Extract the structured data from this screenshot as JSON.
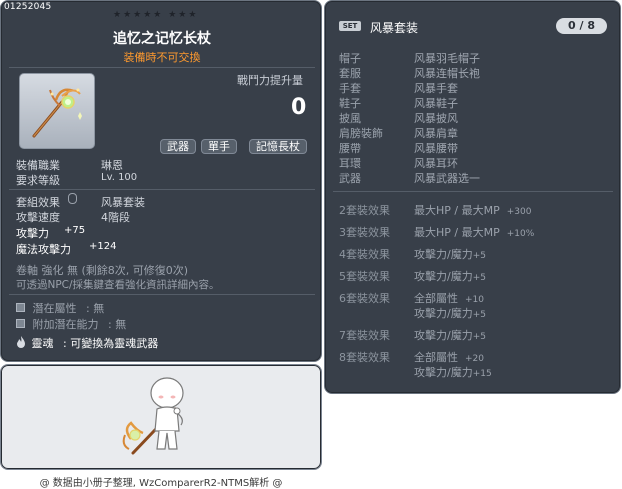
{
  "item": {
    "id": "01252045",
    "stars": "★★★★★  ★★★",
    "title": "追忆之记忆长杖",
    "untradable": "装備時不可交換",
    "combat_power_label": "戰鬥力提升量",
    "combat_power_value": "0",
    "tags": [
      "武器",
      "單手",
      "記憶長杖"
    ],
    "job_label": "裝備職業",
    "job_value": "琳恩",
    "level_label": "要求等級",
    "level_value": "Lv. 100",
    "set_label": "套組效果",
    "set_value": "风暴套装",
    "speed_label": "攻擊速度",
    "speed_value": "4階段",
    "atk_label": "攻擊力",
    "atk_value": "+75",
    "matk_label": "魔法攻擊力",
    "matk_value": "+124",
    "scroll_line": "卷軸 強化 無 (剩餘8次, 可修復0次)",
    "npc_note": "可透過NPC/採集鍵查看強化資訊詳細內容。",
    "potential_label": "潛在屬性",
    "potential_value": ": 無",
    "bonus_potential_label": "附加潛在能力",
    "bonus_potential_value": ": 無",
    "soul_label": "靈魂",
    "soul_value": ": 可變換為靈魂武器"
  },
  "set": {
    "badge": "SET",
    "name": "风暴套装",
    "count": "0 / 8",
    "parts": [
      {
        "slot": "帽子",
        "name": "风暴羽毛帽子"
      },
      {
        "slot": "套服",
        "name": "风暴连帽长袍"
      },
      {
        "slot": "手套",
        "name": "风暴手套"
      },
      {
        "slot": "鞋子",
        "name": "风暴鞋子"
      },
      {
        "slot": "披風",
        "name": "风暴披风"
      },
      {
        "slot": "肩膀裝飾",
        "name": "风暴肩章"
      },
      {
        "slot": "腰帶",
        "name": "风暴腰带"
      },
      {
        "slot": "耳環",
        "name": "风暴耳环"
      },
      {
        "slot": "武器",
        "name": "风暴武器选一"
      }
    ],
    "effects": [
      {
        "label": "2套裝效果",
        "lines": [
          {
            "stat": "最大HP / 最大MP",
            "value": "+300"
          }
        ]
      },
      {
        "label": "3套裝效果",
        "lines": [
          {
            "stat": "最大HP / 最大MP",
            "value": "+10%"
          }
        ]
      },
      {
        "label": "4套裝效果",
        "lines": [
          {
            "stat": "攻擊力/魔力",
            "value": "+5"
          }
        ]
      },
      {
        "label": "5套裝效果",
        "lines": [
          {
            "stat": "攻擊力/魔力",
            "value": "+5"
          }
        ]
      },
      {
        "label": "6套裝效果",
        "lines": [
          {
            "stat": "全部屬性",
            "value": "+10"
          },
          {
            "stat": "攻擊力/魔力",
            "value": "+5"
          }
        ]
      },
      {
        "label": "7套裝效果",
        "lines": [
          {
            "stat": "攻擊力/魔力",
            "value": "+5"
          }
        ]
      },
      {
        "label": "8套裝效果",
        "lines": [
          {
            "stat": "全部屬性",
            "value": "+20"
          },
          {
            "stat": "攻擊力/魔力",
            "value": "+15"
          }
        ]
      }
    ]
  },
  "footer": "@ 数据由小册子整理, WzComparerR2-NTMS解析 @"
}
